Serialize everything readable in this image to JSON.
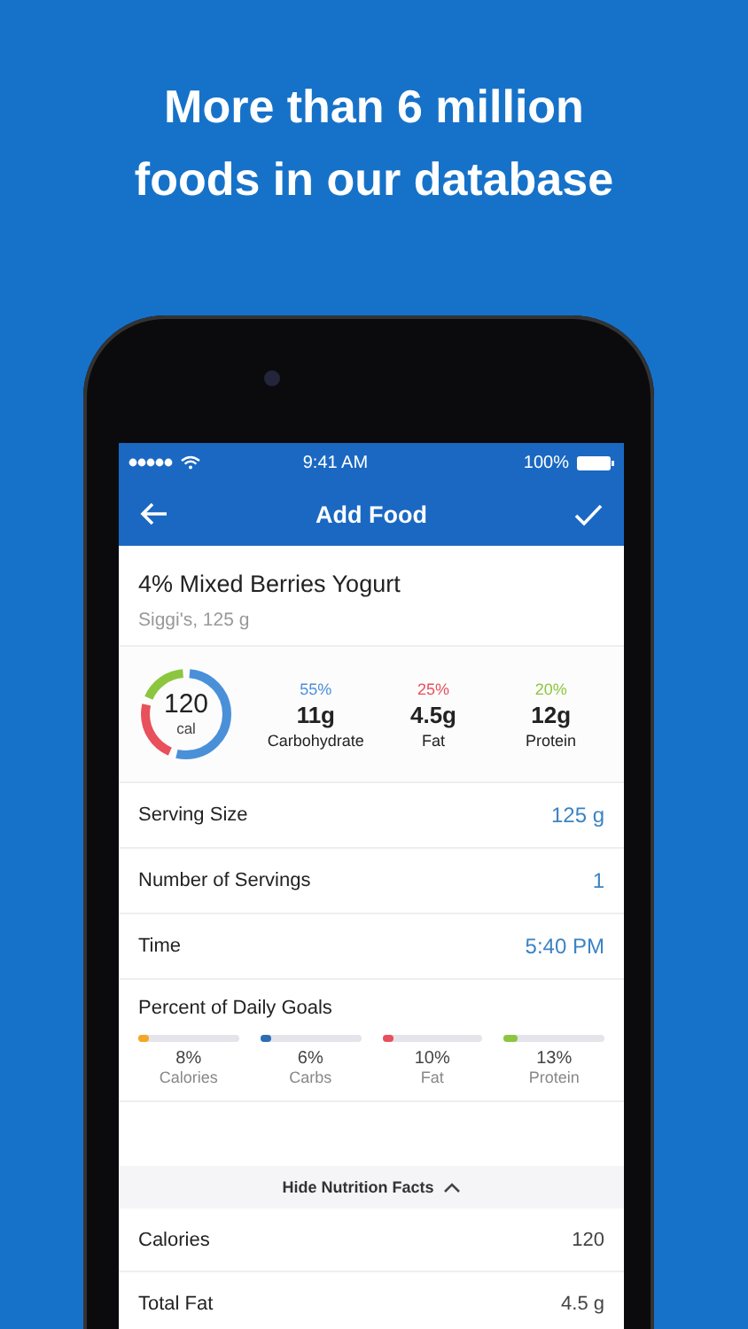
{
  "headline": "More than 6 million foods in our database",
  "status_bar": {
    "time": "9:41 AM",
    "battery": "100%"
  },
  "nav": {
    "title": "Add Food"
  },
  "food": {
    "name": "4% Mixed Berries Yogurt",
    "detail": "Siggi's, 125 g"
  },
  "calories": {
    "value": "120",
    "unit": "cal"
  },
  "macros": [
    {
      "percent": "55%",
      "amount": "11g",
      "label": "Carbohydrate",
      "level": 0.55,
      "color": "#4a90d9"
    },
    {
      "percent": "25%",
      "amount": "4.5g",
      "label": "Fat",
      "level": 0.25,
      "color": "#e8505b"
    },
    {
      "percent": "20%",
      "amount": "12g",
      "label": "Protein",
      "level": 0.2,
      "color": "#8cc63f"
    }
  ],
  "fields": [
    {
      "label": "Serving Size",
      "value": "125 g"
    },
    {
      "label": "Number of Servings",
      "value": "1"
    },
    {
      "label": "Time",
      "value": "5:40 PM"
    }
  ],
  "goals": {
    "title": "Percent of Daily Goals",
    "items": [
      {
        "percent": "8%",
        "label": "Calories",
        "level": 0.08,
        "color": "#f5a623"
      },
      {
        "percent": "6%",
        "label": "Carbs",
        "level": 0.06,
        "color": "#2d6db5"
      },
      {
        "percent": "10%",
        "label": "Fat",
        "level": 0.1,
        "color": "#e8505b"
      },
      {
        "percent": "13%",
        "label": "Protein",
        "level": 0.13,
        "color": "#8cc63f"
      }
    ]
  },
  "toggle": {
    "label": "Hide Nutrition Facts",
    "expanded": true
  },
  "nutrition": [
    {
      "label": "Calories",
      "value": "120"
    },
    {
      "label": "Total Fat",
      "value": "4.5 g"
    }
  ]
}
